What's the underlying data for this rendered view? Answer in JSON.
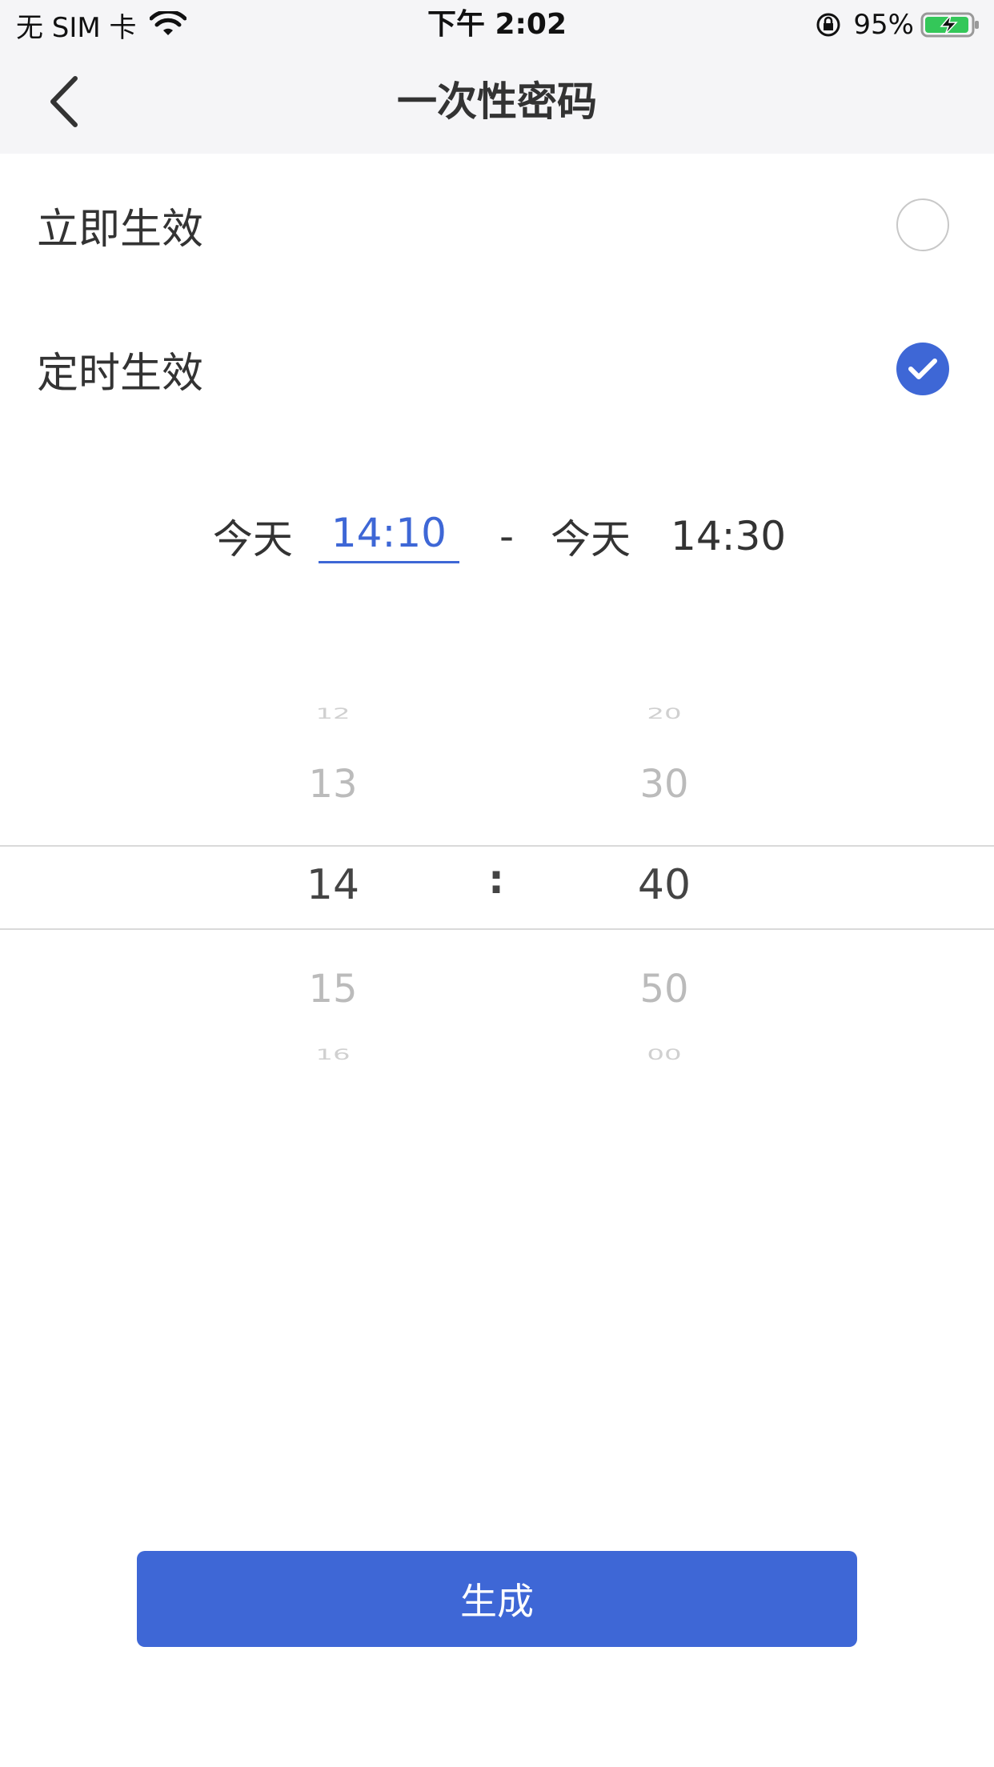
{
  "status_bar": {
    "carrier": "无 SIM 卡",
    "time": "下午 2:02",
    "battery": "95%"
  },
  "nav": {
    "back_icon": "chevron-left-icon",
    "title": "一次性密码"
  },
  "options": [
    {
      "label": "立即生效",
      "selected": false
    },
    {
      "label": "定时生效",
      "selected": true
    }
  ],
  "time_range": {
    "start_day": "今天",
    "start_time": "14:10",
    "separator": "-",
    "end_day": "今天",
    "end_time": "14:30"
  },
  "picker": {
    "hours": [
      "12",
      "13",
      "14",
      "15",
      "16"
    ],
    "minutes": [
      "20",
      "30",
      "40",
      "50",
      "00"
    ],
    "selected_hour": "14",
    "selected_minute": "40",
    "colon": ":"
  },
  "generate_button": {
    "label": "生成"
  },
  "colors": {
    "accent": "#3e67d6",
    "nav_bg": "#f5f5f7"
  }
}
